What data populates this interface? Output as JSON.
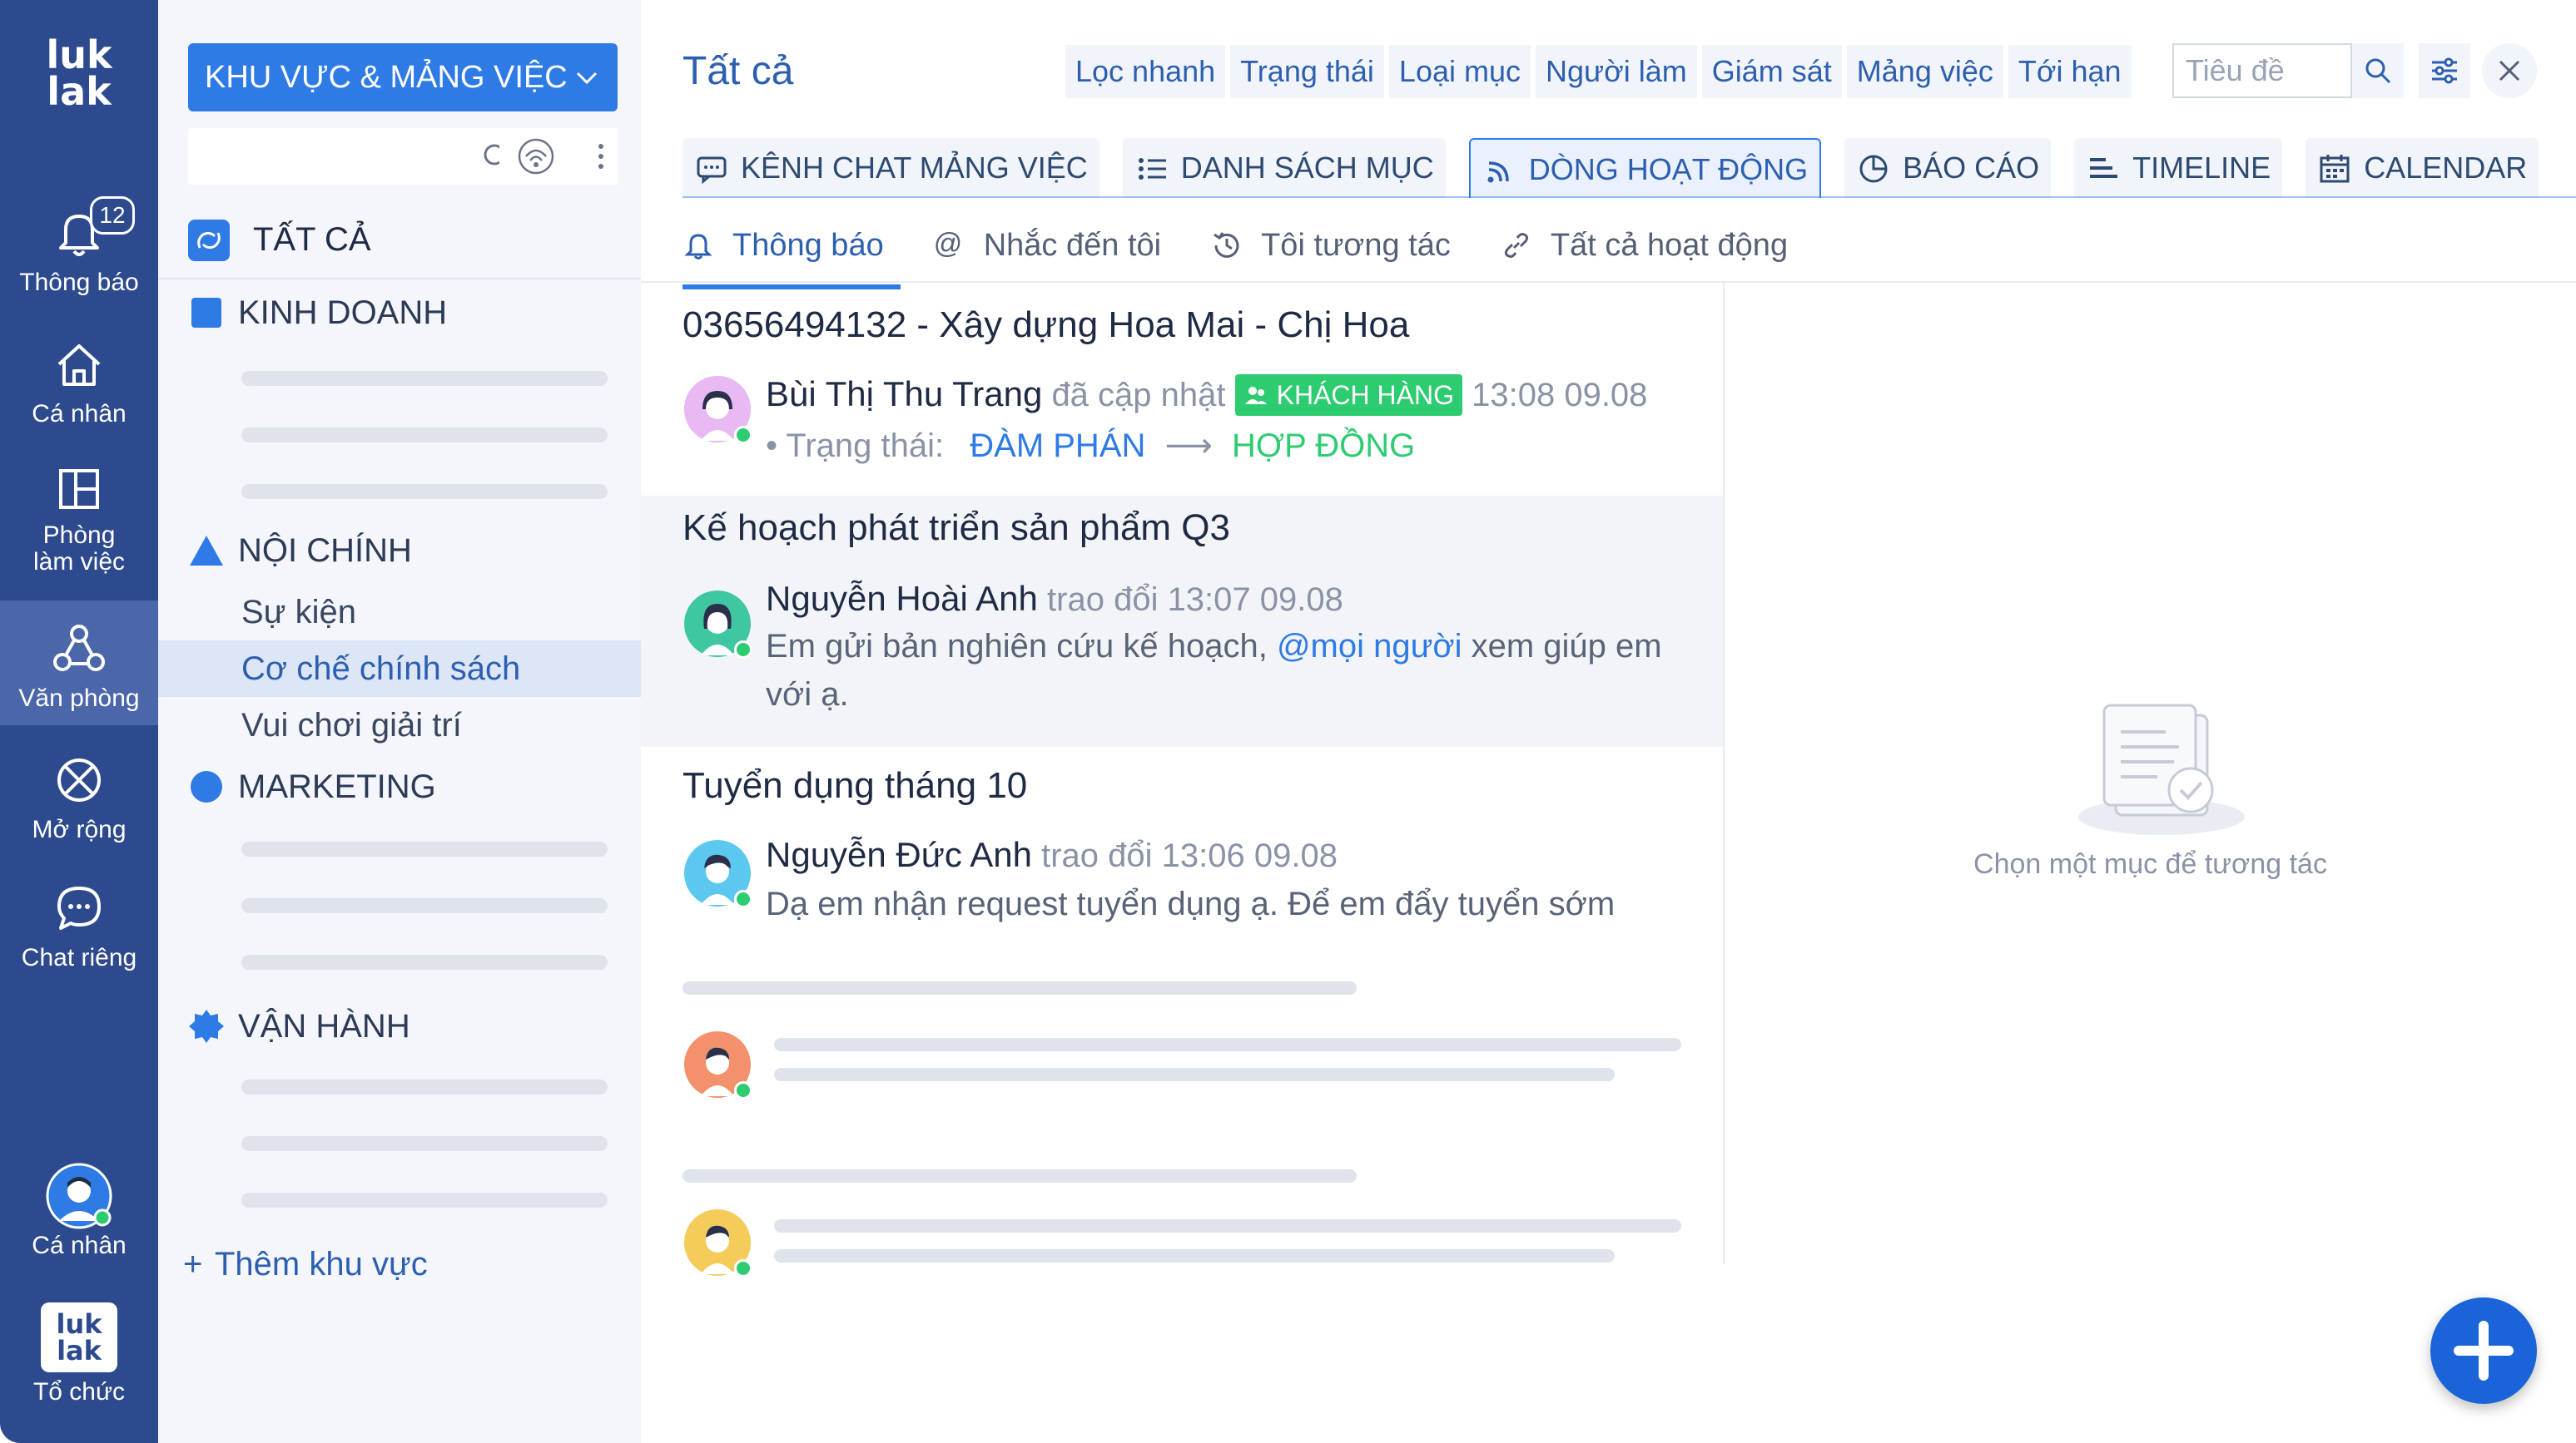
{
  "rail": {
    "logo_line1": "luk",
    "logo_line2": "lak",
    "notifications": {
      "label": "Thông báo",
      "count": "12"
    },
    "personal": {
      "label": "Cá nhân"
    },
    "workroom": {
      "label_1": "Phòng",
      "label_2": "làm việc"
    },
    "office": {
      "label": "Văn phòng"
    },
    "extend": {
      "label": "Mở rộng"
    },
    "private_chat": {
      "label": "Chat riêng"
    },
    "profile": {
      "label": "Cá nhân"
    },
    "org": {
      "label": "Tổ chức"
    }
  },
  "sidebar": {
    "zone_button": "KHU VỰC & MẢNG VIỆC",
    "search_placeholder": "",
    "all_label": "TẤT CẢ",
    "groups": [
      {
        "label": "KINH DOANH",
        "color": "#2e7be6"
      },
      {
        "label": "NỘI CHÍNH",
        "color": "#2e7be6"
      },
      {
        "label": "MARKETING",
        "color": "#2e7be6"
      },
      {
        "label": "VẬN HÀNH",
        "color": "#2e7be6"
      }
    ],
    "noi_chinh_items": [
      "Sự kiện",
      "Cơ chế chính sách",
      "Vui chơi giải trí"
    ],
    "active_item": "Cơ chế chính sách",
    "add_zone": "Thêm khu vực"
  },
  "main": {
    "title": "Tất cả",
    "filters": [
      "Lọc nhanh",
      "Trạng thái",
      "Loại mục",
      "Người làm",
      "Giám sát",
      "Mảng việc",
      "Tới hạn"
    ],
    "title_filter_placeholder": "Tiêu đề",
    "tabs": [
      {
        "label": "KÊNH CHAT MẢNG VIỆC",
        "icon": "chat-icon"
      },
      {
        "label": "DANH SÁCH MỤC",
        "icon": "list-icon"
      },
      {
        "label": "DÒNG HOẠT ĐỘNG",
        "icon": "activity-icon",
        "active": true
      },
      {
        "label": "BÁO CÁO",
        "icon": "report-icon"
      },
      {
        "label": "TIMELINE",
        "icon": "timeline-icon"
      },
      {
        "label": "CALENDAR",
        "icon": "calendar-icon"
      }
    ],
    "subtabs": [
      {
        "label": "Thông báo",
        "active": true
      },
      {
        "label": "Nhắc đến tôi"
      },
      {
        "label": "Tôi tương tác"
      },
      {
        "label": "Tất cả hoạt động"
      }
    ],
    "feed": [
      {
        "title": "03656494132 - Xây dựng Hoa Mai - Chị Hoa",
        "author": "Bùi Thị Thu Trang",
        "action": "đã cập nhật",
        "tag": "KHÁCH HÀNG",
        "time": "13:08 09.08",
        "status_label": "• Trạng thái:",
        "status_from": "ĐÀM PHÁN",
        "status_arrow": "⟶",
        "status_to": "HỢP ĐỒNG"
      },
      {
        "title": "Kế hoạch phát triển sản phẩm Q3",
        "author": "Nguyễn Hoài Anh",
        "action": "trao đổi 13:07 09.08",
        "message_before": "Em gửi bản nghiên cứu kế hoạch, ",
        "mention": "@mọi người",
        "message_after": " xem giúp em với ạ."
      },
      {
        "title": "Tuyển dụng tháng 10",
        "author": "Nguyễn Đức Anh",
        "action": "trao đổi 13:06 09.08",
        "message": "Dạ em nhận request tuyển dụng ạ. Để em đẩy tuyển sớm"
      }
    ],
    "empty_text": "Chọn một mục để tương tác"
  },
  "colors": {
    "rail": "#2d4a8e",
    "accent": "#2e7be6",
    "success": "#2ecc71"
  }
}
